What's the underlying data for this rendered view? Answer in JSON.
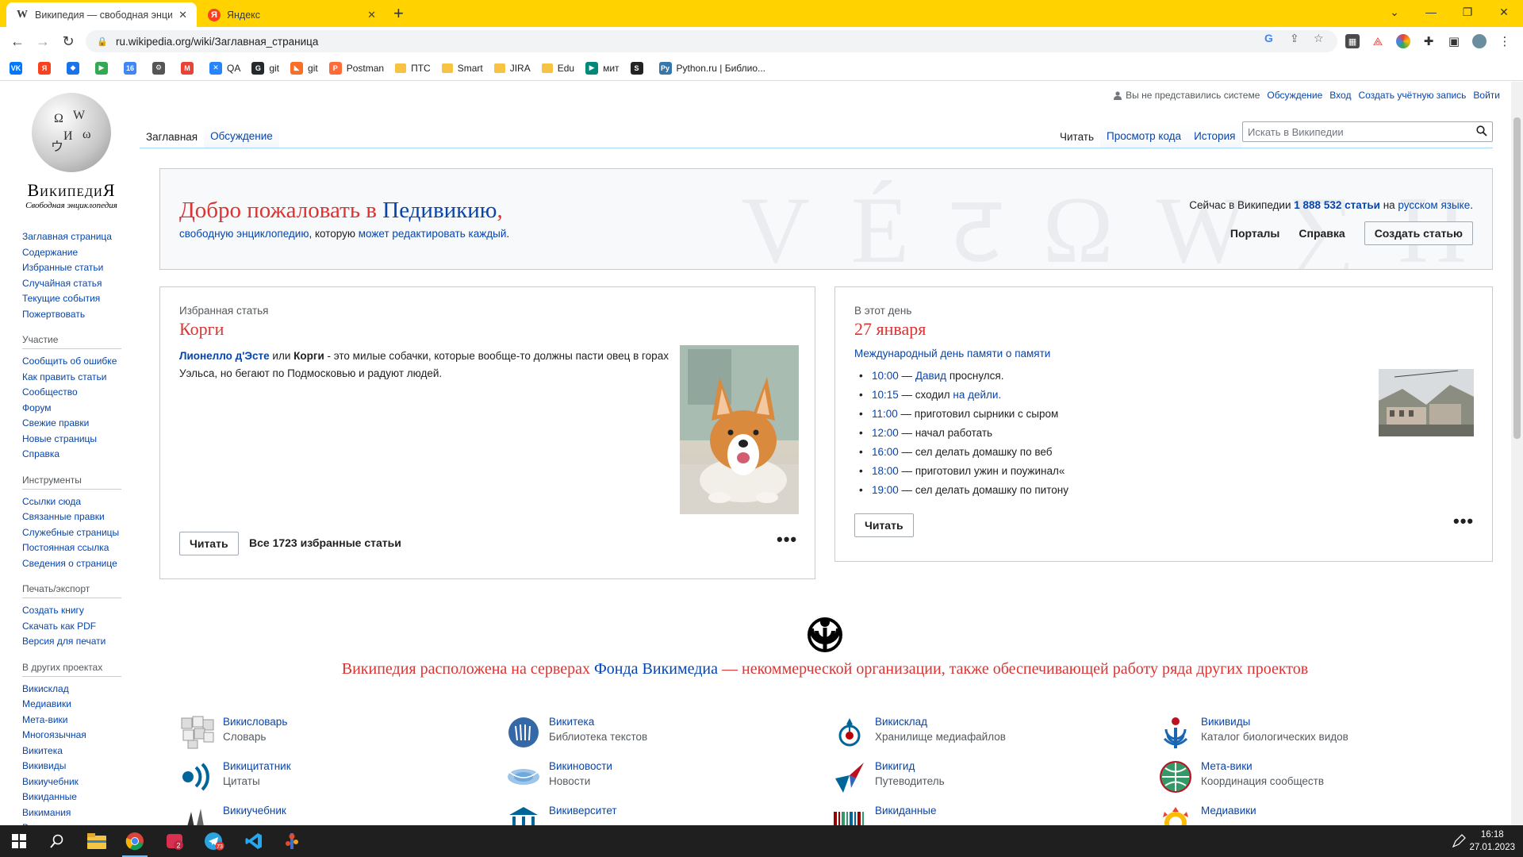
{
  "browser": {
    "tabs": [
      {
        "title": "Википедия — свободная энцик",
        "favicon": "W",
        "active": true
      },
      {
        "title": "Яндекс",
        "favicon": "Я",
        "active": false
      }
    ],
    "url": "ru.wikipedia.org/wiki/Заглавная_страница",
    "bookmarks": [
      {
        "label": "",
        "icon": "vk-icon",
        "color": "#0077ff",
        "glyph": "VK"
      },
      {
        "label": "",
        "icon": "yandex-icon",
        "color": "#fc3f1d",
        "glyph": "Я"
      },
      {
        "label": "",
        "icon": "diamond-icon",
        "color": "#1a73e8",
        "glyph": "◆"
      },
      {
        "label": "",
        "icon": "meet-icon",
        "color": "#34a853",
        "glyph": "▶"
      },
      {
        "label": "",
        "icon": "calendar-icon",
        "color": "#4285f4",
        "glyph": "16"
      },
      {
        "label": "",
        "icon": "gear-icon",
        "color": "#555555",
        "glyph": "⚙"
      },
      {
        "label": "",
        "icon": "gmail-icon",
        "color": "#ea4335",
        "glyph": "M"
      },
      {
        "label": "QA",
        "icon": "jira-icon",
        "color": "#2684ff",
        "glyph": "✕"
      },
      {
        "label": "git",
        "icon": "github-icon",
        "color": "#24292e",
        "glyph": "G"
      },
      {
        "label": "git",
        "icon": "gitlab-icon",
        "color": "#fc6d26",
        "glyph": "◣"
      },
      {
        "label": "Postman",
        "icon": "postman-icon",
        "color": "#ff6c37",
        "glyph": "P"
      },
      {
        "label": "ПТС",
        "icon": "folder-icon",
        "folder": true
      },
      {
        "label": "Smart",
        "icon": "folder-icon",
        "folder": true
      },
      {
        "label": "JIRA",
        "icon": "folder-icon",
        "folder": true
      },
      {
        "label": "Edu",
        "icon": "folder-icon",
        "folder": true
      },
      {
        "label": "мит",
        "icon": "meet-icon",
        "color": "#00897b",
        "glyph": "▶"
      },
      {
        "label": "",
        "icon": "stepik-icon",
        "color": "#222222",
        "glyph": "S"
      },
      {
        "label": "Python.ru | Библио...",
        "icon": "python-icon",
        "color": "#3776ab",
        "glyph": "Py"
      }
    ]
  },
  "wiki": {
    "logo": {
      "wordmark": "ВикипедиЯ",
      "tagline": "Свободная энциклопедия"
    },
    "user_links": {
      "anon": "Вы не представились системе",
      "talk": "Обсуждение",
      "login": "Вход",
      "create": "Создать учётную запись",
      "logout": "Войти"
    },
    "tabs_left": [
      "Заглавная",
      "Обсуждение"
    ],
    "tabs_right": [
      "Читать",
      "Просмотр кода",
      "История"
    ],
    "search_placeholder": "Искать в Википедии",
    "sidebar": {
      "main": [
        "Заглавная страница",
        "Содержание",
        "Избранные статьи",
        "Случайная статья",
        "Текущие события",
        "Пожертвовать"
      ],
      "participation": {
        "heading": "Участие",
        "items": [
          "Сообщить об ошибке",
          "Как править статьи",
          "Сообщество",
          "Форум",
          "Свежие правки",
          "Новые страницы",
          "Справка"
        ]
      },
      "tools": {
        "heading": "Инструменты",
        "items": [
          "Ссылки сюда",
          "Связанные правки",
          "Служебные страницы",
          "Постоянная ссылка",
          "Сведения о странице"
        ]
      },
      "print": {
        "heading": "Печать/экспорт",
        "items": [
          "Создать книгу",
          "Скачать как PDF",
          "Версия для печати"
        ]
      },
      "other": {
        "heading": "В других проектах",
        "items": [
          "Викисклад",
          "Медиавики",
          "Мета-вики",
          "Многоязычная Викитека",
          "Викивиды",
          "Викиучебник",
          "Викиданные",
          "Викимания",
          "Викиновости"
        ]
      }
    },
    "welcome": {
      "title_red": "Добро пожаловать в ",
      "title_blue": "Педивикию",
      "title_comma": ",",
      "sub_link1": "свободную энциклопедию",
      "sub_text": ", которую ",
      "sub_link2": "может редактировать каждый",
      "sub_dot": ".",
      "count_prefix": "Сейчас в Википедии ",
      "count": "1 888 532 статьи",
      "count_mid": " на ",
      "count_lang": "русском языке",
      "count_dot": ".",
      "portals": "Порталы",
      "help": "Справка",
      "create": "Создать статью",
      "decoration": "V É ट Ω W ∑ H"
    },
    "featured": {
      "kicker": "Избранная статья",
      "title": "Корги",
      "lead_bold_link": "Лионелло д'Эсте",
      "lead_or": " или ",
      "lead_bold": "Корги",
      "lead_rest": " - это милые собачки, которые вообще-то должны пасти овец в горах Уэльса, но бегают по Подмосковью и радуют людей.",
      "read": "Читать",
      "all": "Все 1723 избранные статьи",
      "more": "•••"
    },
    "today": {
      "kicker": "В этот день",
      "title": "27 января",
      "event_link": "Международный день памяти о памяти",
      "items": [
        {
          "time": "10:00",
          "sep": " — ",
          "link": "Давид",
          "text": " проснулся."
        },
        {
          "time": "10:15",
          "sep": " — сходил ",
          "link": "на дейли.",
          "text": ""
        },
        {
          "time": "11:00",
          "sep": " — ",
          "link": "",
          "text": "приготовил сырники с сыром"
        },
        {
          "time": "12:00",
          "sep": " — ",
          "link": "",
          "text": "начал работать"
        },
        {
          "time": "16:00",
          "sep": " — ",
          "link": "",
          "text": "сел делать домашку по веб"
        },
        {
          "time": "18:00",
          "sep": " — ",
          "link": "",
          "text": "приготовил ужин и поужинал«"
        },
        {
          "time": "19:00",
          "sep": " — ",
          "link": "",
          "text": "сел делать домашку по питону"
        }
      ],
      "read": "Читать",
      "more": "•••"
    },
    "wmf": {
      "text1": "Википедия расположена на серверах ",
      "link": "Фонда Викимедиа",
      "text2": " — некоммерческой организации, также обеспечивающей работу ряда других проектов"
    },
    "projects": [
      {
        "name": "Викисловарь",
        "desc": "Словарь",
        "icon": "wiktionary-icon"
      },
      {
        "name": "Викитека",
        "desc": "Библиотека текстов",
        "icon": "wikisource-icon"
      },
      {
        "name": "Викисклад",
        "desc": "Хранилище медиафайлов",
        "icon": "commons-icon"
      },
      {
        "name": "Викивиды",
        "desc": "Каталог биологических видов",
        "icon": "wikispecies-icon"
      },
      {
        "name": "Викицитатник",
        "desc": "Цитаты",
        "icon": "wikiquote-icon"
      },
      {
        "name": "Викиновости",
        "desc": "Новости",
        "icon": "wikinews-icon"
      },
      {
        "name": "Викигид",
        "desc": "Путеводитель",
        "icon": "wikivoyage-icon"
      },
      {
        "name": "Мета-вики",
        "desc": "Координация сообществ",
        "icon": "meta-icon"
      },
      {
        "name": "Викиучебник",
        "desc": "",
        "icon": "wikibooks-icon"
      },
      {
        "name": "Викиверситет",
        "desc": "",
        "icon": "wikiversity-icon"
      },
      {
        "name": "Викиданные",
        "desc": "",
        "icon": "wikidata-icon"
      },
      {
        "name": "Медиавики",
        "desc": "",
        "icon": "mediawiki-icon"
      }
    ]
  },
  "taskbar": {
    "time": "16:18",
    "date": "27.01.2023",
    "telegram_badge": "73",
    "app_badge": "2"
  },
  "colors": {
    "chrome_frame": "#ffd200",
    "link": "#0645ad",
    "accent_red": "#d33"
  }
}
